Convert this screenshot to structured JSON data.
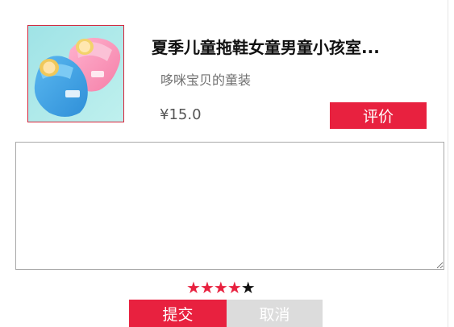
{
  "product": {
    "title": "夏季儿童拖鞋女童男童小孩室...",
    "shop": "哆咪宝贝的童装",
    "price": "¥15.0",
    "image_description": "pink and blue children's slippers with cartoon badge"
  },
  "actions": {
    "review_label": "评价",
    "submit_label": "提交",
    "cancel_label": "取消"
  },
  "comment": {
    "value": "",
    "placeholder": ""
  },
  "rating": {
    "value": 4,
    "max": 5,
    "star_glyph": "★"
  },
  "colors": {
    "accent": "#e8213f",
    "cancel_bg": "#dcdcdc"
  }
}
